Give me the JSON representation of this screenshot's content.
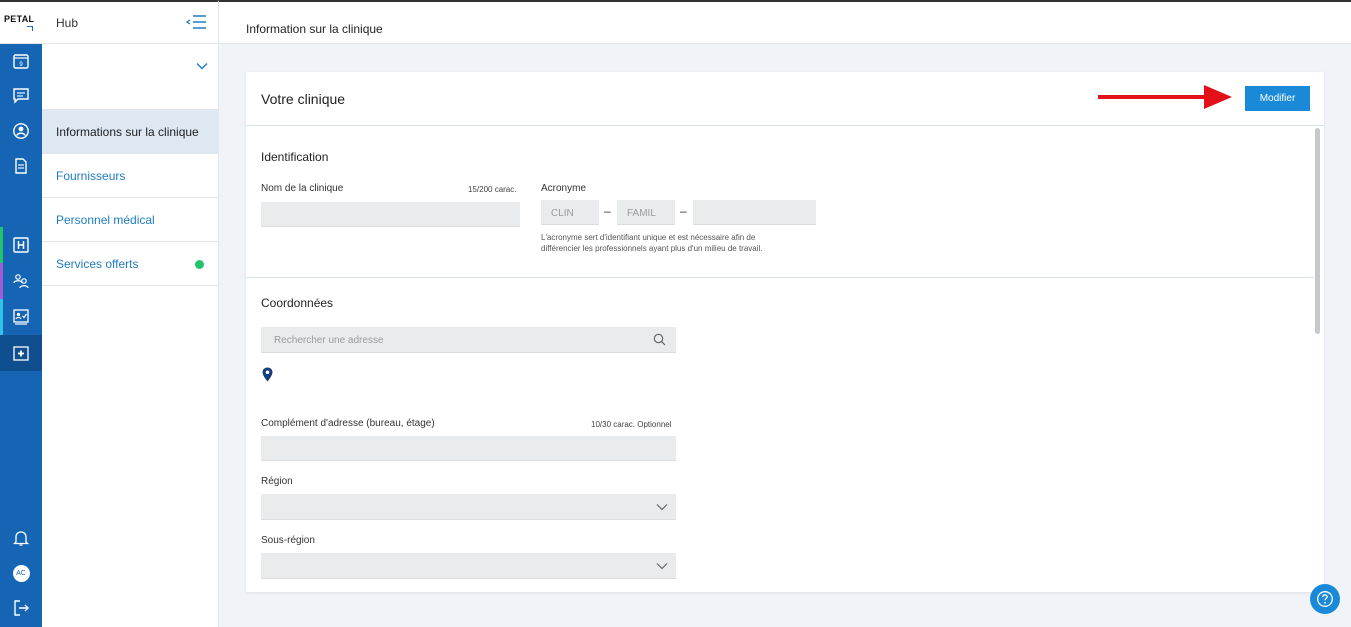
{
  "brand": {
    "logo": "PETAL"
  },
  "hub": {
    "title": "Hub"
  },
  "header": {
    "title": "Information sur la clinique"
  },
  "rail": {
    "calendar_day": "9",
    "avatar_initials": "AC"
  },
  "sidebar": {
    "items": [
      {
        "label": "Informations sur la clinique",
        "active": true
      },
      {
        "label": "Fournisseurs"
      },
      {
        "label": "Personnel médical"
      },
      {
        "label": "Services offerts",
        "status_color": "#22c36b"
      }
    ]
  },
  "card": {
    "title": "Votre clinique",
    "modify_label": "Modifier"
  },
  "identification": {
    "title": "Identification",
    "clinic_name_label": "Nom de la clinique",
    "clinic_name_counter": "15/200 carac.",
    "clinic_name_value": "",
    "acronym_label": "Acronyme",
    "acronym_part1_placeholder": "CLIN",
    "acronym_part2_placeholder": "FAMIL",
    "acronym_part3_value": "",
    "acronym_separator": "–",
    "acronym_help_line1": "L'acronyme sert d'identifiant unique et est nécessaire afin de",
    "acronym_help_line2": "différencier les professionnels ayant plus d'un milieu de travail."
  },
  "coordinates": {
    "title": "Coordonnées",
    "search_placeholder": "Rechercher une adresse",
    "complement_label": "Complément d'adresse (bureau, étage)",
    "complement_counter": "10/30 carac. Optionnel",
    "region_label": "Région",
    "subregion_label": "Sous-région"
  },
  "colors": {
    "rail": "#1565b4",
    "accent": "#1a8ad8",
    "arrow": "#e3101a"
  }
}
